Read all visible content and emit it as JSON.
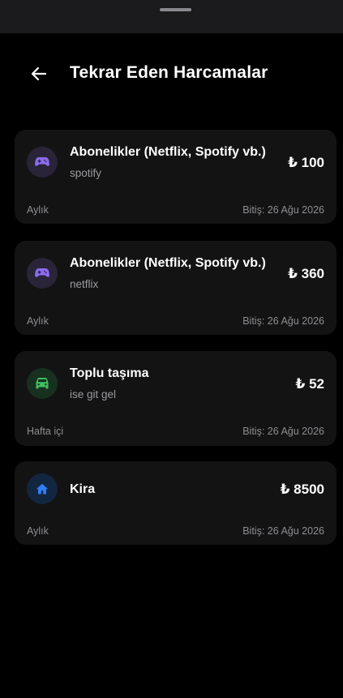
{
  "header": {
    "title": "Tekrar Eden Harcamalar",
    "back_icon": "arrow-left-icon"
  },
  "colors": {
    "background": "#000000",
    "card": "#131314",
    "subscription_icon": "#8b6cf0",
    "subscription_bg": "#2a2438",
    "transport_icon": "#3fbf5f",
    "transport_bg": "#18301f",
    "rent_icon": "#2f7df6",
    "rent_bg": "#132640"
  },
  "expenses": [
    {
      "category": "Abonelikler (Netflix, Spotify vb.)",
      "note": "spotify",
      "amount": "₺ 100",
      "frequency": "Aylık",
      "end_date": "Bitiş: 26 Ağu 2026",
      "icon": "gamepad-icon"
    },
    {
      "category": "Abonelikler (Netflix, Spotify vb.)",
      "note": "netflix",
      "amount": "₺ 360",
      "frequency": "Aylık",
      "end_date": "Bitiş: 26 Ağu 2026",
      "icon": "gamepad-icon"
    },
    {
      "category": "Toplu taşıma",
      "note": "ise git gel",
      "amount": "₺ 52",
      "frequency": "Hafta içi",
      "end_date": "Bitiş: 26 Ağu 2026",
      "icon": "car-icon"
    },
    {
      "category": "Kira",
      "amount": "₺ 8500",
      "frequency": "Aylık",
      "end_date": "Bitiş: 26 Ağu 2026",
      "icon": "home-icon"
    }
  ]
}
